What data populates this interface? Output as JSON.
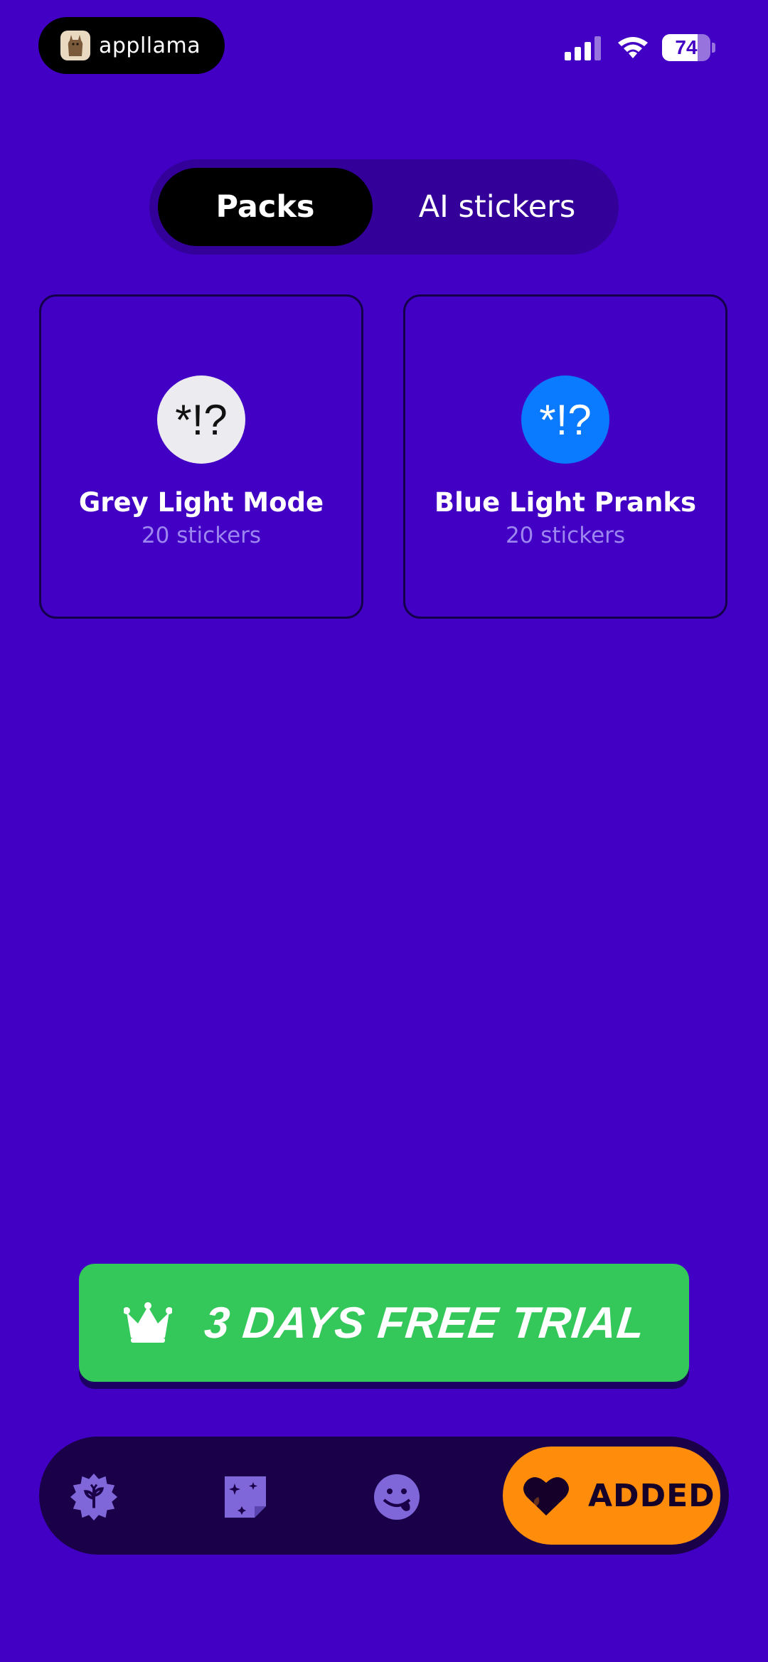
{
  "status_bar": {
    "app_name": "appllama",
    "battery": "74",
    "battery_level": 0.74,
    "icons": [
      "signal-icon",
      "wifi-icon",
      "battery-icon"
    ]
  },
  "tabs": [
    {
      "label": "Packs",
      "selected": true
    },
    {
      "label": "AI stickers",
      "selected": false
    }
  ],
  "packs": [
    {
      "icon_text": "*!?",
      "title": "Grey Light Mode",
      "count": "20 stickers",
      "icon_bg": "#ececf0",
      "icon_fg": "#111111"
    },
    {
      "icon_text": "*!?",
      "title": "Blue Light Pranks",
      "count": "20 stickers",
      "icon_bg": "#0a7aff",
      "icon_fg": "#ffffff"
    }
  ],
  "trial_button": {
    "label": "3 DAYS FREE TRIAL",
    "icon": "crown-icon",
    "color": "#34c759"
  },
  "bottom_nav": {
    "items": [
      {
        "icon": "badge-plant-icon"
      },
      {
        "icon": "sparkle-sticker-icon"
      },
      {
        "icon": "smiley-tongue-icon"
      }
    ],
    "added": {
      "label": "ADDED",
      "icon": "heart-icon",
      "color": "#ff8d0b"
    }
  },
  "colors": {
    "background": "#4200c4",
    "segment_bg": "#33009a",
    "nav_bg": "#1a0048",
    "muted_text": "#9d86f0"
  }
}
